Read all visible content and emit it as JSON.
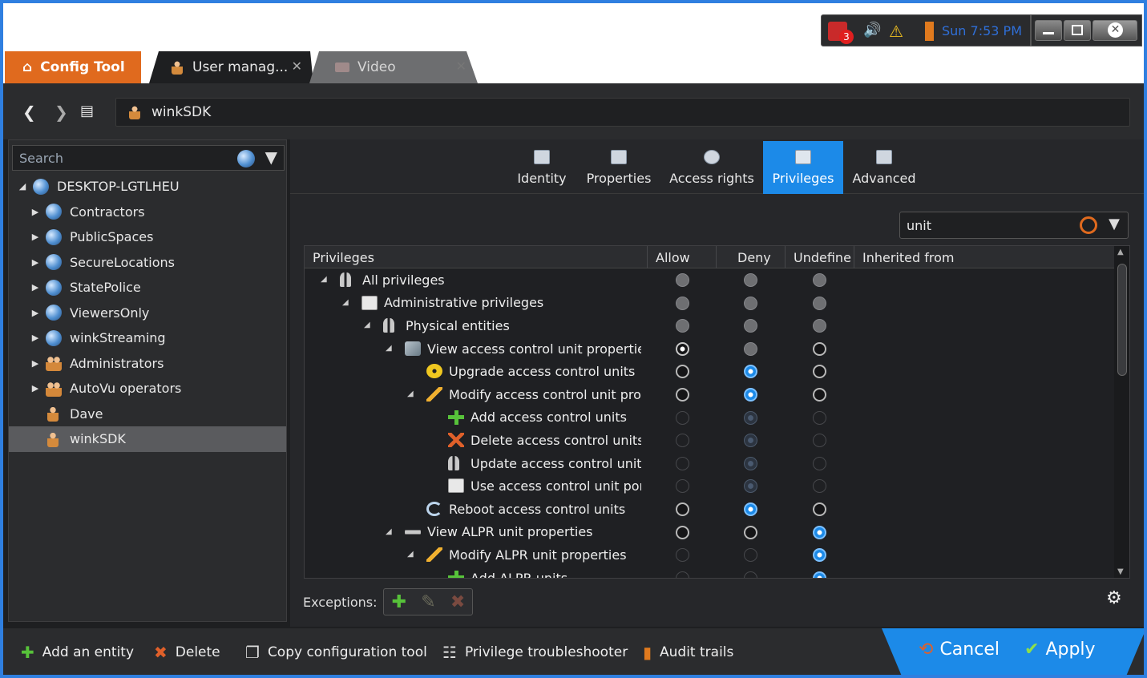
{
  "tray": {
    "badge_count": "3",
    "clock": "Sun 7:53 PM"
  },
  "tabs": [
    {
      "label": "Config Tool"
    },
    {
      "label": "User manag..."
    },
    {
      "label": "Video"
    }
  ],
  "address": {
    "value": "winkSDK"
  },
  "left": {
    "search_placeholder": "Search",
    "tree": [
      {
        "label": "DESKTOP-LGTLHEU",
        "level": 0,
        "icon": "globe",
        "expand": "open"
      },
      {
        "label": "Contractors",
        "level": 1,
        "icon": "globe",
        "expand": "closed"
      },
      {
        "label": "PublicSpaces",
        "level": 1,
        "icon": "globe",
        "expand": "closed"
      },
      {
        "label": "SecureLocations",
        "level": 1,
        "icon": "globe",
        "expand": "closed"
      },
      {
        "label": "StatePolice",
        "level": 1,
        "icon": "globe",
        "expand": "closed"
      },
      {
        "label": "ViewersOnly",
        "level": 1,
        "icon": "globe",
        "expand": "closed"
      },
      {
        "label": "winkStreaming",
        "level": 1,
        "icon": "globe",
        "expand": "closed"
      },
      {
        "label": "Administrators",
        "level": 1,
        "icon": "people",
        "expand": "closed"
      },
      {
        "label": "AutoVu operators",
        "level": 1,
        "icon": "people",
        "expand": "closed"
      },
      {
        "label": "Dave",
        "level": 1,
        "icon": "person",
        "expand": "none"
      },
      {
        "label": "winkSDK",
        "level": 1,
        "icon": "person",
        "expand": "none",
        "selected": true
      }
    ]
  },
  "page_tabs": [
    {
      "label": "Identity"
    },
    {
      "label": "Properties"
    },
    {
      "label": "Access rights"
    },
    {
      "label": "Privileges",
      "active": true
    },
    {
      "label": "Advanced"
    }
  ],
  "filter": {
    "value": "unit"
  },
  "grid": {
    "headers": {
      "privileges": "Privileges",
      "allow": "Allow",
      "deny": "Deny",
      "undefine": "Undefine",
      "inherited": "Inherited from"
    },
    "rows": [
      {
        "label": "All privileges",
        "level": 0,
        "expand": true,
        "icon": "keys-icon",
        "allow": "gray",
        "deny": "gray",
        "undefine": "gray"
      },
      {
        "label": "Administrative privileges",
        "level": 1,
        "expand": true,
        "icon": "card-icon",
        "allow": "gray",
        "deny": "gray",
        "undefine": "gray"
      },
      {
        "label": "Physical entities",
        "level": 2,
        "expand": true,
        "icon": "keys-icon",
        "allow": "gray",
        "deny": "gray",
        "undefine": "gray"
      },
      {
        "label": "View access control unit properties",
        "level": 3,
        "expand": true,
        "icon": "unit-icon",
        "allow": "white",
        "deny": "gray",
        "undefine": "dark"
      },
      {
        "label": "Upgrade access control units",
        "level": 4,
        "expand": false,
        "icon": "radiation-icon",
        "allow": "dark",
        "deny": "blue",
        "undefine": "dark"
      },
      {
        "label": "Modify access control unit prope",
        "level": 4,
        "expand": true,
        "icon": "pencil-icon",
        "allow": "dark",
        "deny": "blue",
        "undefine": "dark"
      },
      {
        "label": "Add access control units",
        "level": 5,
        "expand": false,
        "icon": "plus-icon",
        "allow": "faint",
        "deny": "fblue",
        "undefine": "faint"
      },
      {
        "label": "Delete access control units",
        "level": 5,
        "expand": false,
        "icon": "x-icon",
        "allow": "faint",
        "deny": "fblue",
        "undefine": "faint"
      },
      {
        "label": "Update access control unit pa",
        "level": 5,
        "expand": false,
        "icon": "keys-icon",
        "allow": "faint",
        "deny": "fblue",
        "undefine": "faint"
      },
      {
        "label": "Use access control unit porta",
        "level": 5,
        "expand": false,
        "icon": "card-icon",
        "allow": "faint",
        "deny": "fblue",
        "undefine": "faint"
      },
      {
        "label": "Reboot access control units",
        "level": 4,
        "expand": false,
        "icon": "reboot-icon",
        "allow": "dark",
        "deny": "blue",
        "undefine": "dark"
      },
      {
        "label": "View ALPR unit properties",
        "level": 3,
        "expand": true,
        "icon": "alpr-icon",
        "allow": "dark",
        "deny": "dark",
        "undefine": "blue"
      },
      {
        "label": "Modify ALPR unit properties",
        "level": 4,
        "expand": true,
        "icon": "pencil-icon",
        "allow": "faint",
        "deny": "faint",
        "undefine": "blue"
      },
      {
        "label": "Add ALPR units",
        "level": 5,
        "expand": false,
        "icon": "plus-icon",
        "allow": "faint",
        "deny": "faint",
        "undefine": "blue"
      }
    ]
  },
  "exceptions_label": "Exceptions:",
  "bottom": {
    "add_entity": "Add an entity",
    "delete": "Delete",
    "copy_config": "Copy configuration tool",
    "troubleshooter": "Privilege troubleshooter",
    "audit": "Audit trails",
    "cancel": "Cancel",
    "apply": "Apply"
  }
}
